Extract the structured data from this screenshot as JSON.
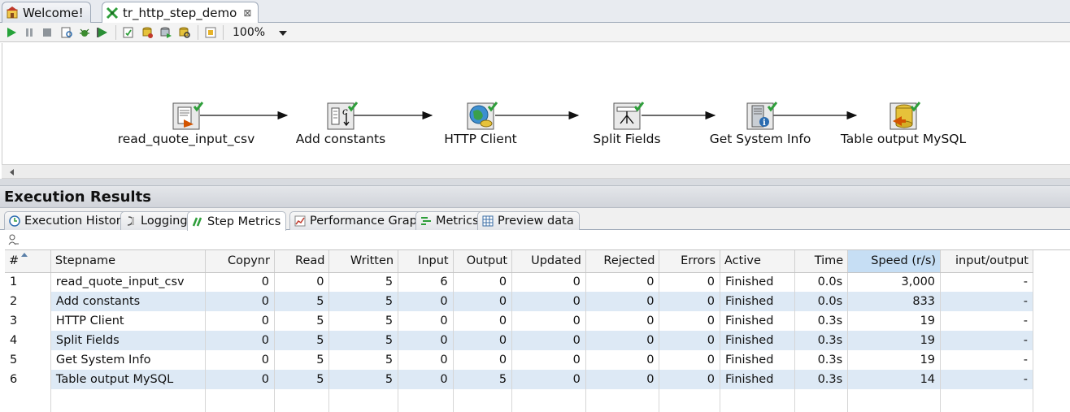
{
  "editor_tabs": [
    {
      "label": "Welcome!",
      "icon": "home-icon",
      "active": false
    },
    {
      "label": "tr_http_step_demo",
      "icon": "transformation-icon",
      "active": true,
      "close": "⊠"
    }
  ],
  "toolbar": {
    "buttons": [
      "run-icon",
      "pause-icon",
      "stop-icon",
      "preview-icon",
      "debug-icon",
      "replay-icon",
      "verify-icon",
      "impact-icon",
      "sql-icon",
      "database-explore-icon",
      "show-results-icon"
    ],
    "zoom": "100%"
  },
  "steps": [
    {
      "name": "read_quote_input_csv",
      "icon": "csv-input-icon"
    },
    {
      "name": "Add constants",
      "icon": "constants-icon"
    },
    {
      "name": "HTTP Client",
      "icon": "http-client-icon"
    },
    {
      "name": "Split Fields",
      "icon": "split-fields-icon"
    },
    {
      "name": "Get System Info",
      "icon": "system-info-icon"
    },
    {
      "name": "Table output MySQL",
      "icon": "table-output-icon"
    }
  ],
  "execution": {
    "title": "Execution Results",
    "tabs": [
      {
        "label": "Execution History",
        "icon": "history-icon",
        "active": false
      },
      {
        "label": "Logging",
        "icon": "logging-icon",
        "active": false
      },
      {
        "label": "Step Metrics",
        "icon": "step-metrics-icon",
        "active": true
      },
      {
        "label": "Performance Graph",
        "icon": "performance-graph-icon",
        "active": false
      },
      {
        "label": "Metrics",
        "icon": "metrics-icon",
        "active": false
      },
      {
        "label": "Preview data",
        "icon": "preview-data-icon",
        "active": false
      }
    ]
  },
  "grid": {
    "columns": [
      "#",
      "Stepname",
      "Copynr",
      "Read",
      "Written",
      "Input",
      "Output",
      "Updated",
      "Rejected",
      "Errors",
      "Active",
      "Time",
      "Speed (r/s)",
      "input/output"
    ],
    "sorted_column": "Speed (r/s)",
    "rows": [
      [
        "1",
        "read_quote_input_csv",
        "0",
        "0",
        "5",
        "6",
        "0",
        "0",
        "0",
        "0",
        "Finished",
        "0.0s",
        "3,000",
        "-"
      ],
      [
        "2",
        "Add constants",
        "0",
        "5",
        "5",
        "0",
        "0",
        "0",
        "0",
        "0",
        "Finished",
        "0.0s",
        "833",
        "-"
      ],
      [
        "3",
        "HTTP Client",
        "0",
        "5",
        "5",
        "0",
        "0",
        "0",
        "0",
        "0",
        "Finished",
        "0.3s",
        "19",
        "-"
      ],
      [
        "4",
        "Split Fields",
        "0",
        "5",
        "5",
        "0",
        "0",
        "0",
        "0",
        "0",
        "Finished",
        "0.3s",
        "19",
        "-"
      ],
      [
        "5",
        "Get System Info",
        "0",
        "5",
        "5",
        "0",
        "0",
        "0",
        "0",
        "0",
        "Finished",
        "0.3s",
        "19",
        "-"
      ],
      [
        "6",
        "Table output MySQL",
        "0",
        "5",
        "5",
        "0",
        "5",
        "0",
        "0",
        "0",
        "Finished",
        "0.3s",
        "14",
        "-"
      ]
    ]
  },
  "colors": {
    "row_alt": "#dde9f5",
    "sorted_header": "#c6def4",
    "check_green": "#2e9e3a"
  }
}
